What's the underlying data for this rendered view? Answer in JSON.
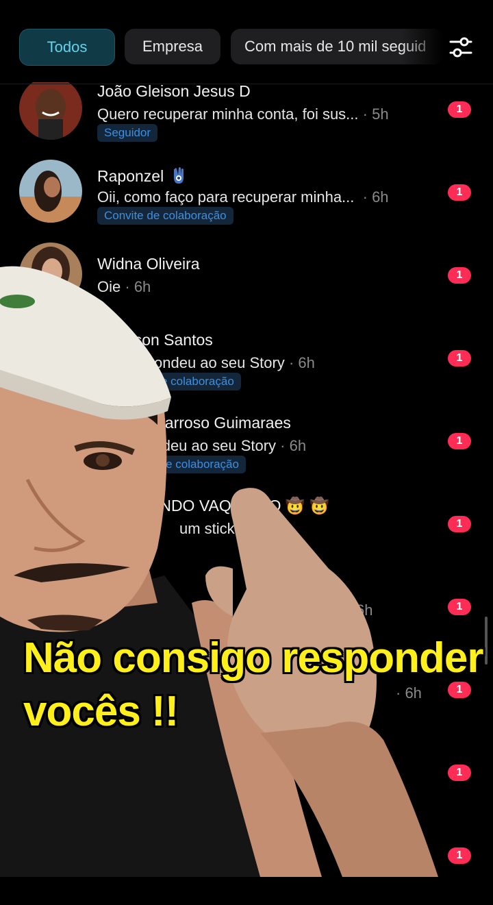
{
  "filters": {
    "chips": [
      "Todos",
      "Empresa",
      "Com mais de 10 mil seguid"
    ],
    "active_index": 0,
    "icon": "sliders-icon"
  },
  "messages": [
    {
      "name": "João Gleison Jesus D",
      "preview": "Quero recuperar minha conta, foi sus...",
      "time": "· 5h",
      "tag": "Seguidor",
      "badge": "1"
    },
    {
      "name": "Raponzel",
      "name_emoji": "hamsa-icon",
      "preview": "Oii, como faço para recuperar minha...",
      "time": "· 6h",
      "tag": "Convite de colaboração",
      "badge": "1"
    },
    {
      "name": "Widna Oliveira",
      "preview": "Oie",
      "time": "· 6h",
      "tag": "",
      "badge": "1"
    },
    {
      "name": "Denyson Santos",
      "preview": "ondeu ao seu Story",
      "time": "· 6h",
      "tag": "e colaboração",
      "badge": "1"
    },
    {
      "name": "barroso Guimaraes",
      "preview": "bondeu ao seu Story",
      "time": "· 6h",
      "tag": "ite de colaboração",
      "badge": "1"
    },
    {
      "name": "ANDO VAQUE  RO 🤠 🤠",
      "preview": "um sticker",
      "time": "· 6h",
      "tag": "r",
      "badge": "1"
    },
    {
      "name": "",
      "preview": "",
      "time": "6h",
      "tag": "",
      "badge": "1"
    },
    {
      "name": "",
      "preview": "",
      "time": "· 6h",
      "tag": "",
      "badge": "1"
    },
    {
      "name": "",
      "preview": "",
      "time": "",
      "tag": "",
      "badge": "1"
    },
    {
      "name": "",
      "preview": "",
      "time": "",
      "tag": "",
      "badge": "1"
    }
  ],
  "caption": {
    "line1": "Não consigo responder",
    "line2": "vocês !!"
  },
  "colors": {
    "badge": "#ff2d55",
    "caption": "#ffef1a",
    "active_chip": "#0f3a46",
    "tag": "#3d8fe0"
  }
}
